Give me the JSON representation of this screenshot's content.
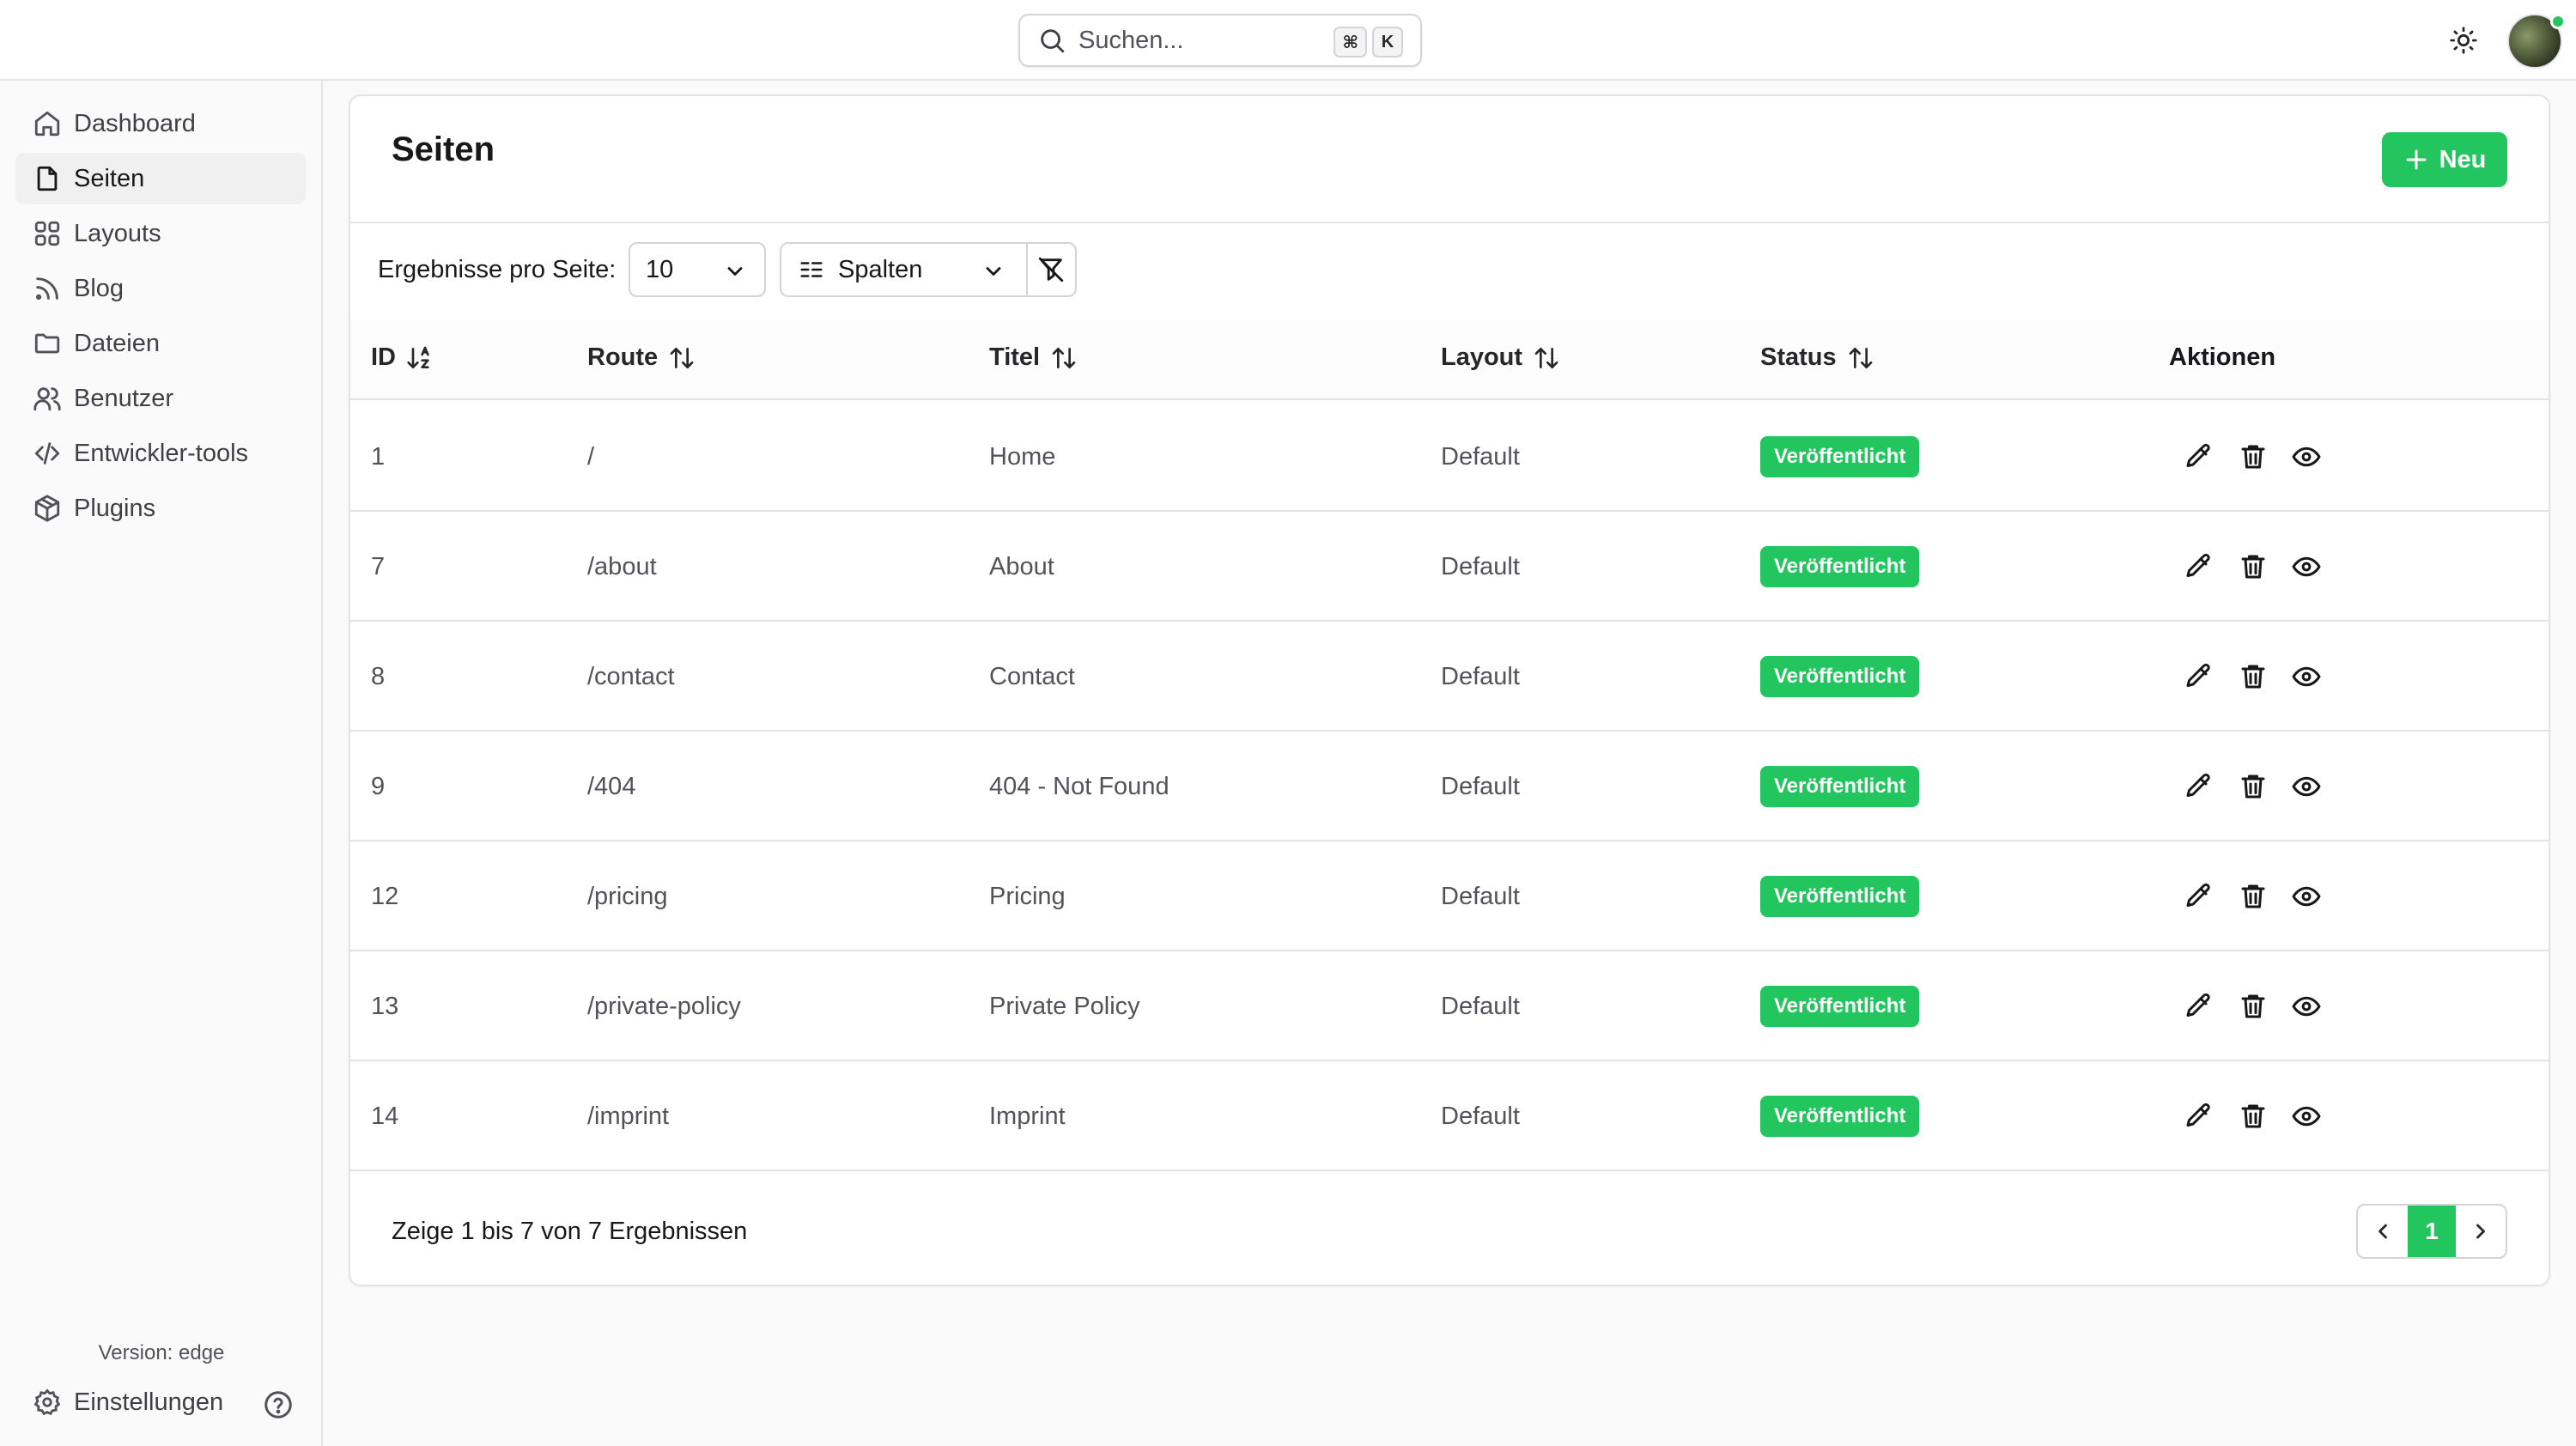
{
  "search": {
    "placeholder": "Suchen...",
    "kbd_cmd": "⌘",
    "kbd_key": "K"
  },
  "sidebar": {
    "items": [
      {
        "label": "Dashboard",
        "icon": "home-icon"
      },
      {
        "label": "Seiten",
        "icon": "file-icon",
        "active": true
      },
      {
        "label": "Layouts",
        "icon": "layout-grid-icon"
      },
      {
        "label": "Blog",
        "icon": "rss-icon"
      },
      {
        "label": "Dateien",
        "icon": "folder-icon"
      },
      {
        "label": "Benutzer",
        "icon": "users-icon"
      },
      {
        "label": "Entwickler-tools",
        "icon": "code-icon"
      },
      {
        "label": "Plugins",
        "icon": "package-icon"
      }
    ],
    "version": "Version: edge",
    "settings_label": "Einstellungen"
  },
  "page": {
    "title": "Seiten",
    "new_button": "Neu",
    "results_per_page_label": "Ergebnisse pro Seite:",
    "results_per_page_value": "10",
    "columns_button": "Spalten"
  },
  "table": {
    "headers": {
      "id": "ID",
      "route": "Route",
      "title": "Titel",
      "layout": "Layout",
      "status": "Status",
      "actions": "Aktionen"
    },
    "rows": [
      {
        "id": "1",
        "route": "/",
        "title": "Home",
        "layout": "Default",
        "status": "Veröffentlicht"
      },
      {
        "id": "7",
        "route": "/about",
        "title": "About",
        "layout": "Default",
        "status": "Veröffentlicht"
      },
      {
        "id": "8",
        "route": "/contact",
        "title": "Contact",
        "layout": "Default",
        "status": "Veröffentlicht"
      },
      {
        "id": "9",
        "route": "/404",
        "title": "404 - Not Found",
        "layout": "Default",
        "status": "Veröffentlicht"
      },
      {
        "id": "12",
        "route": "/pricing",
        "title": "Pricing",
        "layout": "Default",
        "status": "Veröffentlicht"
      },
      {
        "id": "13",
        "route": "/private-policy",
        "title": "Private Policy",
        "layout": "Default",
        "status": "Veröffentlicht"
      },
      {
        "id": "14",
        "route": "/imprint",
        "title": "Imprint",
        "layout": "Default",
        "status": "Veröffentlicht"
      }
    ]
  },
  "footer": {
    "summary": "Zeige 1 bis 7 von 7 Ergebnissen",
    "current_page": "1"
  },
  "colors": {
    "accent": "#22c55e",
    "border": "#e4e4e7",
    "text": "#18181b",
    "muted": "#52525b"
  }
}
